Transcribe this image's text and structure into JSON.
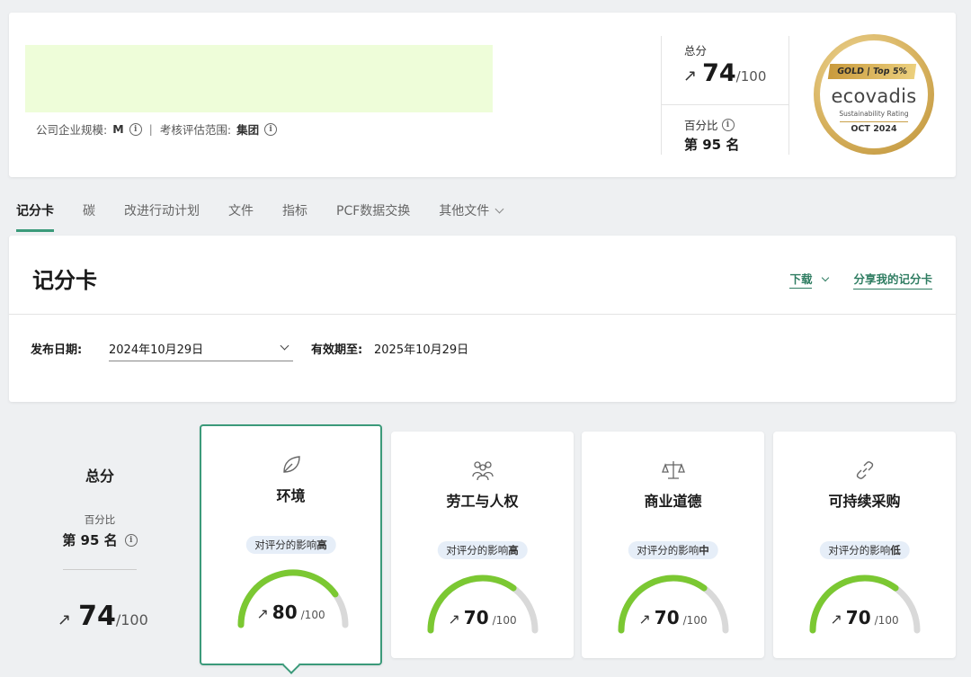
{
  "company": {
    "size_label": "公司企业规模:",
    "size_value": "M",
    "scope_label": "考核评估范围:",
    "scope_value": "集团",
    "separator": "|"
  },
  "overall": {
    "score_label": "总分",
    "score": "74",
    "score_out_of": "/100",
    "percentile_label": "百分比",
    "rank": "第 95 名"
  },
  "medal": {
    "ribbon": "GOLD | Top 5%",
    "brand": "ecovadis",
    "subtitle": "Sustainability Rating",
    "date": "OCT 2024"
  },
  "tabs": [
    {
      "label": "记分卡",
      "active": true
    },
    {
      "label": "碳"
    },
    {
      "label": "改进行动计划"
    },
    {
      "label": "文件"
    },
    {
      "label": "指标"
    },
    {
      "label": "PCF数据交换"
    },
    {
      "label": "其他文件"
    }
  ],
  "scorecard": {
    "title": "记分卡",
    "download_label": "下载",
    "share_label": "分享我的记分卡",
    "publish_label": "发布日期:",
    "publish_date": "2024年10月29日",
    "valid_label": "有效期至:",
    "valid_date": "2025年10月29日"
  },
  "summary": {
    "title": "总分",
    "percentile_label": "百分比",
    "rank": "第 95 名",
    "score": "74",
    "score_out_of": "/100"
  },
  "themes": [
    {
      "name": "环境",
      "impact_prefix": "对评分的影响",
      "impact_level": "高",
      "score": "80",
      "out_of": "/100",
      "value": 80,
      "icon": "leaf-icon"
    },
    {
      "name": "劳工与人权",
      "impact_prefix": "对评分的影响",
      "impact_level": "高",
      "score": "70",
      "out_of": "/100",
      "value": 70,
      "icon": "people-icon"
    },
    {
      "name": "商业道德",
      "impact_prefix": "对评分的影响",
      "impact_level": "中",
      "score": "70",
      "out_of": "/100",
      "value": 70,
      "icon": "scales-icon"
    },
    {
      "name": "可持续采购",
      "impact_prefix": "对评分的影响",
      "impact_level": "低",
      "score": "70",
      "out_of": "/100",
      "value": 70,
      "icon": "link-icon"
    }
  ],
  "colors": {
    "accent": "#3b9a7a",
    "gauge_fill": "#7bc832",
    "gauge_track": "#d9d9d9",
    "impact_badge": "#e6eef8"
  }
}
